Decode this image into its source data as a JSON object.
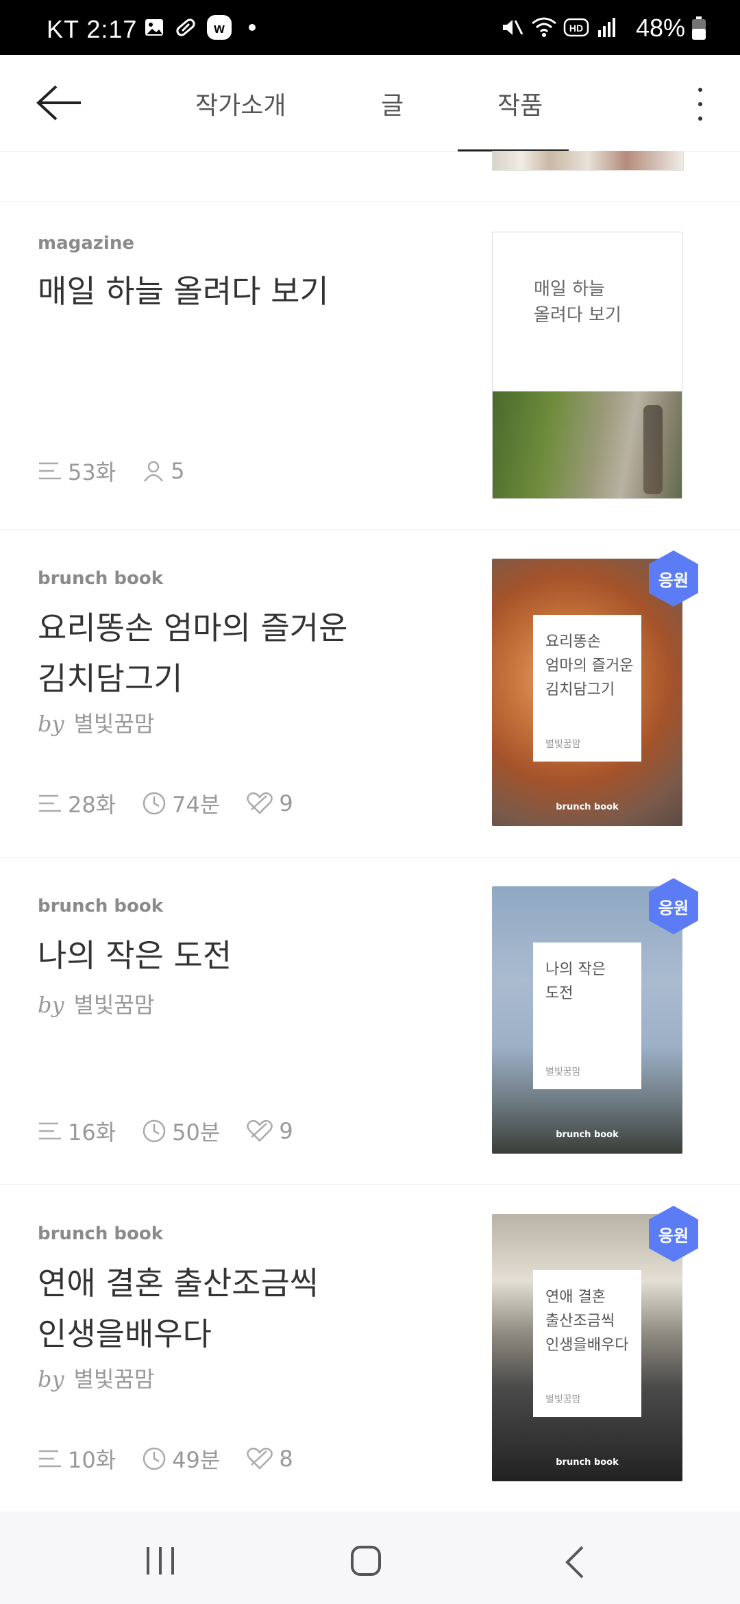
{
  "status_bar": {
    "carrier_time": "KT 2:17",
    "battery": "48%"
  },
  "header": {
    "tabs": [
      "작가소개",
      "글",
      "작품"
    ],
    "active_tab": "작품"
  },
  "items": [
    {
      "kind": "magazine",
      "title": "매일 하늘 올려다 보기",
      "episodes": "53화",
      "subscribers": "5",
      "cover_title": "매일 하늘\n올려다 보기"
    },
    {
      "kind": "brunch book",
      "title": "요리똥손 엄마의 즐거운\n김치담그기",
      "by": "by",
      "author": "별빛꿈맘",
      "episodes": "28화",
      "duration": "74분",
      "likes": "9",
      "cover_title": "요리똥손\n엄마의 즐거운\n김치담그기",
      "cover_author": "별빛꿈맘",
      "cover_brand": "brunch book",
      "badge": "응원"
    },
    {
      "kind": "brunch book",
      "title": "나의 작은 도전",
      "by": "by",
      "author": "별빛꿈맘",
      "episodes": "16화",
      "duration": "50분",
      "likes": "9",
      "cover_title": "나의 작은\n도전",
      "cover_author": "별빛꿈맘",
      "cover_brand": "brunch book",
      "badge": "응원"
    },
    {
      "kind": "brunch book",
      "title": "연애 결혼 출산조금씩\n인생을배우다",
      "by": "by",
      "author": "별빛꿈맘",
      "episodes": "10화",
      "duration": "49분",
      "likes": "8",
      "cover_title": "연애 결혼\n출산조금씩\n인생을배우다",
      "cover_author": "별빛꿈맘",
      "cover_brand": "brunch book",
      "badge": "응원"
    }
  ],
  "colors": {
    "badge": "#5b7cf4",
    "text_primary": "#333333",
    "text_muted": "#999999"
  },
  "icons": [
    "back-arrow-icon",
    "more-vertical-icon",
    "list-icon",
    "person-icon",
    "clock-icon",
    "heart-icon",
    "recents-icon",
    "home-icon",
    "nav-back-icon"
  ]
}
